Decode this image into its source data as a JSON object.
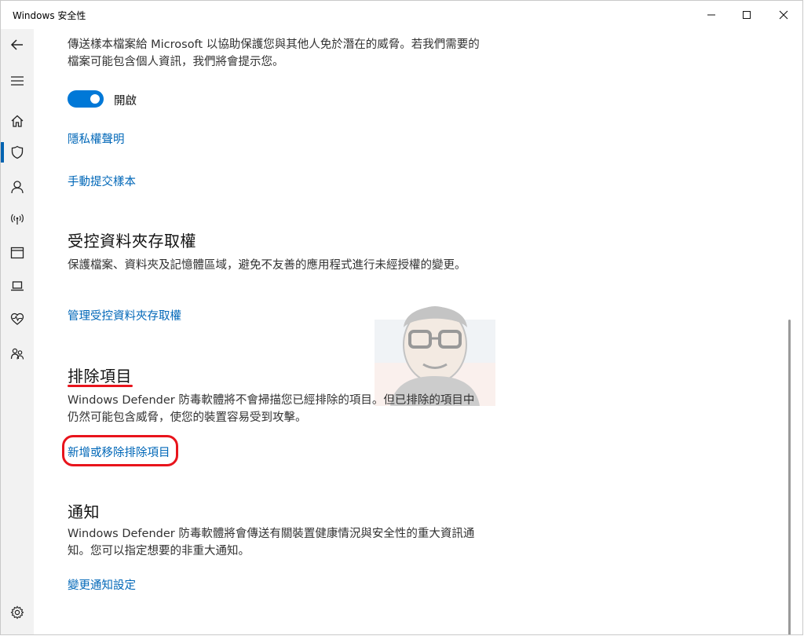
{
  "window": {
    "title": "Windows 安全性",
    "controls": [
      "minimize",
      "maximize",
      "close"
    ]
  },
  "nav_rail": {
    "items": [
      {
        "icon": "back-arrow-icon"
      },
      {
        "icon": "hamburger-menu-icon"
      },
      {
        "icon": "home-icon"
      },
      {
        "icon": "shield-icon",
        "active": true
      },
      {
        "icon": "account-icon"
      },
      {
        "icon": "network-antenna-icon"
      },
      {
        "icon": "app-browser-icon"
      },
      {
        "icon": "device-laptop-icon"
      },
      {
        "icon": "health-heart-icon"
      },
      {
        "icon": "family-icon"
      },
      {
        "icon": "settings-gear-icon"
      }
    ],
    "accent": "#0063b1"
  },
  "sample_submission": {
    "description": "傳送樣本檔案給 Microsoft 以協助保護您與其他人免於潛在的威脅。若我們需要的檔案可能包含個人資訊，我們將會提示您。",
    "toggle_label": "開啟",
    "toggle_on": true,
    "privacy_link": "隱私權聲明",
    "manual_submit_link": "手動提交樣本"
  },
  "controlled_folder": {
    "heading": "受控資料夾存取權",
    "description": "保護檔案、資料夾及記憶體區域，避免不友善的應用程式進行未經授權的變更。",
    "link": "管理受控資料夾存取權"
  },
  "exclusions": {
    "heading": "排除項目",
    "description": "Windows Defender 防毒軟體將不會掃描您已經排除的項目。但已排除的項目中仍然可能包含威脅，使您的裝置容易受到攻擊。",
    "link": "新增或移除排除項目"
  },
  "notifications": {
    "heading": "通知",
    "description": "Windows Defender 防毒軟體將會傳送有關裝置健康情況與安全性的重大資訊通知。您可以指定想要的非重大通知。",
    "link": "變更通知設定"
  },
  "colors": {
    "link": "#0067b8",
    "toggle": "#0078d7",
    "highlight": "#e8141c"
  }
}
